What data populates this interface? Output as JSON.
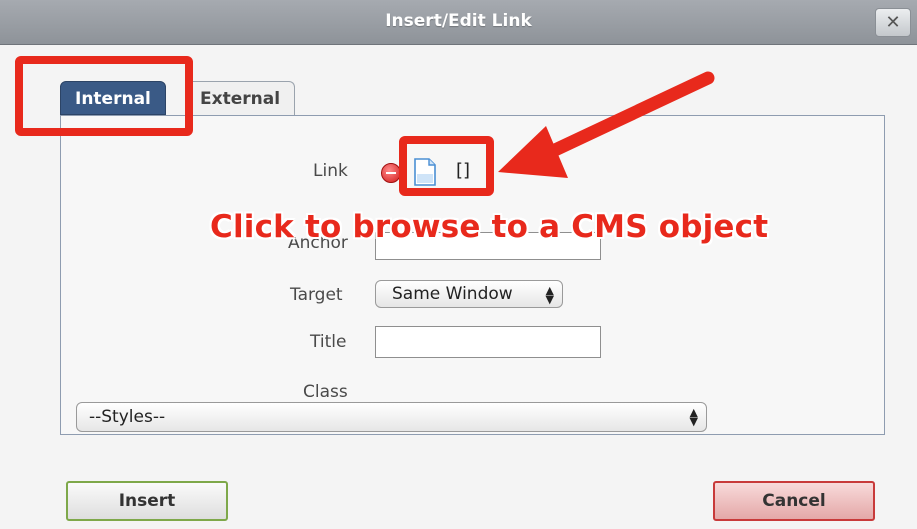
{
  "window": {
    "title": "Insert/Edit Link",
    "close_glyph": "✕"
  },
  "tabs": [
    {
      "label": "Internal",
      "active": true
    },
    {
      "label": "External",
      "active": false
    }
  ],
  "form": {
    "link_label": "Link",
    "link_value": "[]",
    "anchor_label": "Anchor",
    "anchor_value": "",
    "target_label": "Target",
    "target_value": "Same Window",
    "title_label": "Title",
    "title_value": "",
    "class_label": "Class",
    "class_value": "--Styles--"
  },
  "buttons": {
    "insert": "Insert",
    "cancel": "Cancel"
  },
  "annotation": {
    "caption": "Click to browse to a CMS object",
    "color": "#e8291c"
  },
  "colors": {
    "active_tab": "#3a5a86",
    "insert_border": "#7ea84a",
    "cancel_border": "#c83a3a"
  }
}
